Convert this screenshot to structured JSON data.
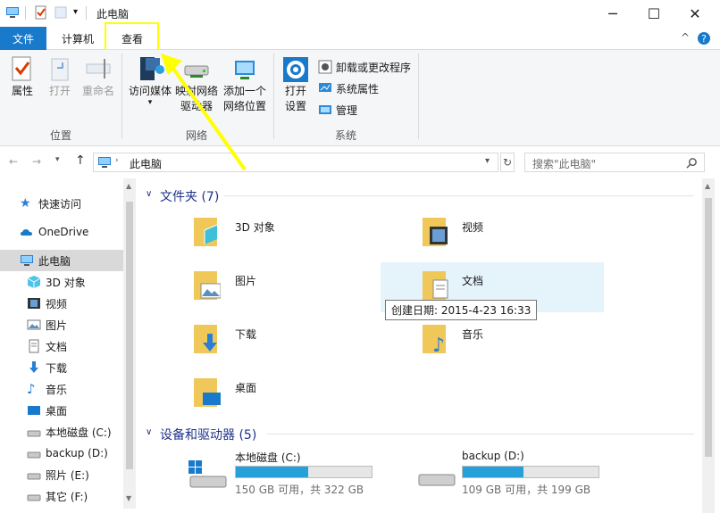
{
  "window": {
    "title": "此电脑",
    "controls": {
      "minimize": "─",
      "maximize": "☐",
      "close": "✕"
    }
  },
  "ribbon_tabs": {
    "file": "文件",
    "computer": "计算机",
    "view": "查看"
  },
  "ribbon": {
    "groups": {
      "location": {
        "label": "位置",
        "buttons": {
          "properties": "属性",
          "open": "打开",
          "rename": "重命名"
        }
      },
      "network": {
        "label": "网络",
        "buttons": {
          "access_media": "访问媒体",
          "map_drive_line1": "映射网络",
          "map_drive_line2": "驱动器",
          "add_location_line1": "添加一个",
          "add_location_line2": "网络位置"
        }
      },
      "system": {
        "label": "系统",
        "open_settings_line1": "打开",
        "open_settings_line2": "设置",
        "uninstall": "卸载或更改程序",
        "sys_props": "系统属性",
        "manage": "管理"
      }
    }
  },
  "address": {
    "path": "此电脑",
    "search_placeholder": "搜索\"此电脑\""
  },
  "nav": {
    "quick_access": "快速访问",
    "onedrive": "OneDrive",
    "this_pc": "此电脑",
    "items": [
      "3D 对象",
      "视频",
      "图片",
      "文档",
      "下载",
      "音乐",
      "桌面",
      "本地磁盘 (C:)",
      "backup (D:)",
      "照片 (E:)",
      "其它 (F:)"
    ]
  },
  "folders_section": {
    "title": "文件夹 (7)",
    "items": {
      "objects3d": "3D 对象",
      "videos": "视频",
      "pictures": "图片",
      "documents": "文档",
      "downloads": "下载",
      "music": "音乐",
      "desktop": "桌面"
    },
    "tooltip": "创建日期: 2015-4-23 16:33"
  },
  "drives_section": {
    "title": "设备和驱动器 (5)",
    "drives": [
      {
        "name": "本地磁盘 (C:)",
        "used_fraction": 0.534,
        "free_text": "150 GB 可用，共 322 GB"
      },
      {
        "name": "backup (D:)",
        "used_fraction": 0.45,
        "free_text": "109 GB 可用，共 199 GB"
      }
    ]
  },
  "colors": {
    "accent": "#1979ca",
    "section_head": "#1e3287",
    "selection": "#cce8ff",
    "drive_fill": "#26a0da",
    "highlight_box": "#ffff00"
  }
}
